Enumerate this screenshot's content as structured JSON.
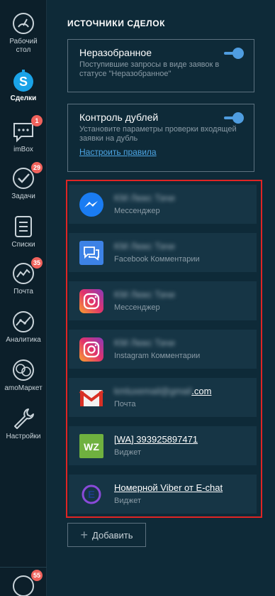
{
  "nav": {
    "items": [
      {
        "label": "Рабочий\nстол",
        "icon": "dashboard-icon"
      },
      {
        "label": "Сделки",
        "icon": "leads-icon"
      },
      {
        "label": "imBox",
        "icon": "chat-icon",
        "badge": "1"
      },
      {
        "label": "Задачи",
        "icon": "tasks-icon",
        "badge": "29"
      },
      {
        "label": "Списки",
        "icon": "lists-icon"
      },
      {
        "label": "Почта",
        "icon": "mail-icon",
        "badge": "35"
      },
      {
        "label": "Аналитика",
        "icon": "analytics-icon"
      },
      {
        "label": "amoМаркет",
        "icon": "market-icon"
      },
      {
        "label": "Настройки",
        "icon": "settings-icon"
      }
    ],
    "profile_badge": "55"
  },
  "panel": {
    "title": "ИСТОЧНИКИ СДЕЛОК",
    "unsorted": {
      "title": "Неразобранное",
      "desc": "Поступившие запросы в виде заявок в статусе \"Неразобранное\"",
      "enabled": true
    },
    "duplicates": {
      "title": "Контроль дублей",
      "desc": "Установите параметры проверки входящей заявки на дубль",
      "link": "Настроить правила",
      "enabled": true
    },
    "sources": [
      {
        "name": "KM Люкс Тачи",
        "type": "Мессенджер",
        "icon": "messenger-icon"
      },
      {
        "name": "KM Люкс Тачи",
        "type": "Facebook Комментарии",
        "icon": "facebook-comments-icon"
      },
      {
        "name": "KM Люкс Тачи",
        "type": "Мессенджер",
        "icon": "instagram-icon"
      },
      {
        "name": "KM Люкс Тачи",
        "type": "Instagram Комментарии",
        "icon": "instagram-icon"
      },
      {
        "name_hidden": "kmluxemail@gmail",
        "name_suffix": ".com",
        "type": "Почта",
        "icon": "gmail-icon"
      },
      {
        "name": "[WA] 393925897471",
        "type": "Виджет",
        "icon": "wz-icon",
        "icon_text": "WZ"
      },
      {
        "name": "Номерной Viber от E-chat",
        "type": "Виджет",
        "icon": "echat-icon",
        "icon_text": "E"
      }
    ],
    "add_label": "Добавить"
  }
}
